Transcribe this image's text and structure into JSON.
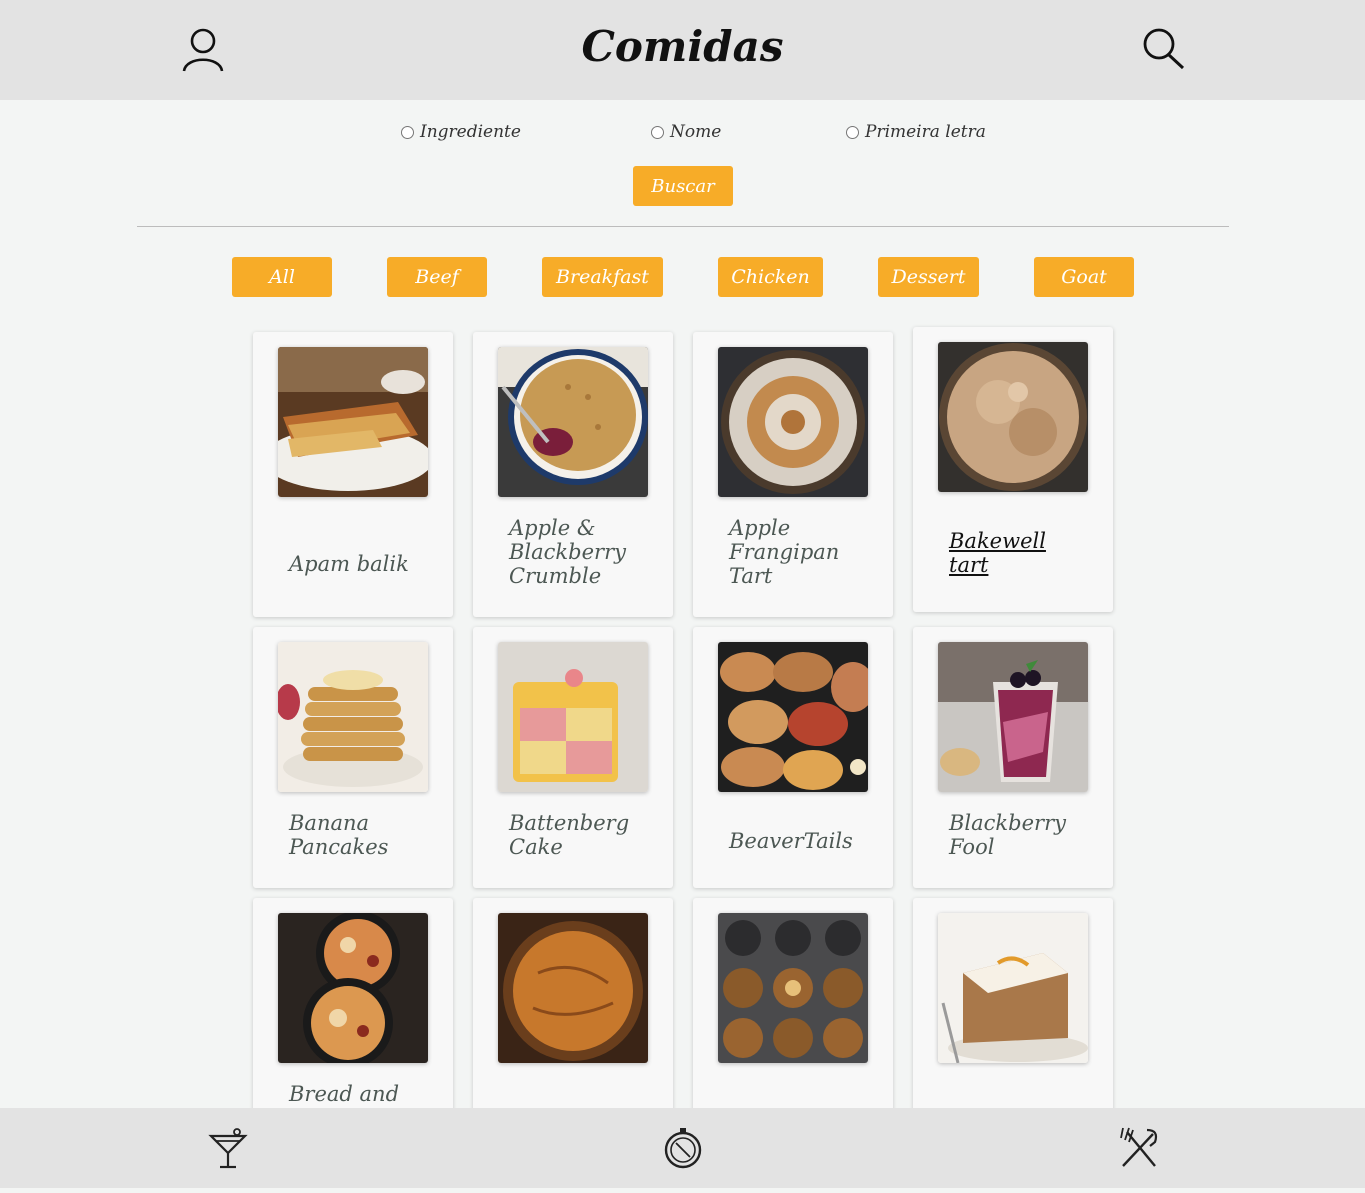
{
  "header": {
    "title": "Comidas",
    "profile_icon": "profile-icon",
    "search_icon": "search-icon"
  },
  "search": {
    "options": [
      "Ingrediente",
      "Nome",
      "Primeira letra"
    ],
    "button_label": "Buscar"
  },
  "categories": [
    "All",
    "Beef",
    "Breakfast",
    "Chicken",
    "Dessert",
    "Goat"
  ],
  "recipes": [
    {
      "name": "Apam balik"
    },
    {
      "name": "Apple & Blackberry Crumble"
    },
    {
      "name": "Apple Frangipan Tart"
    },
    {
      "name": "Bakewell tart"
    },
    {
      "name": "Banana Pancakes"
    },
    {
      "name": "Battenberg Cake"
    },
    {
      "name": "BeaverTails"
    },
    {
      "name": "Blackberry Fool"
    },
    {
      "name": "Bread and"
    }
  ],
  "footer": {
    "icons": [
      "drinks-icon",
      "explore-icon",
      "meals-icon"
    ]
  },
  "colors": {
    "accent": "#f7ac28",
    "header_bg": "#e3e3e3",
    "page_bg": "#f3f5f4",
    "card_text": "#4c5753"
  }
}
